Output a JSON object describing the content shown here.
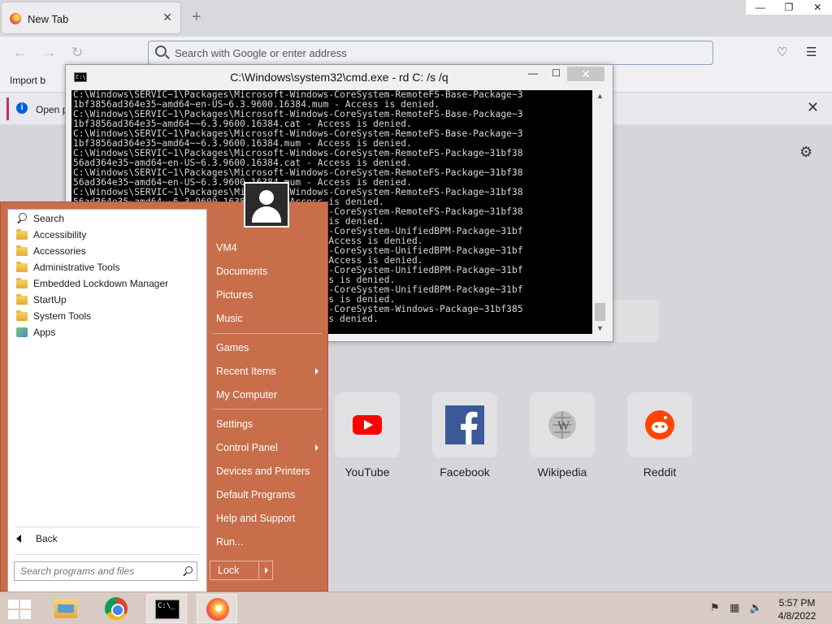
{
  "browser": {
    "tab_title": "New Tab",
    "tab_close": "✕",
    "new_tab": "+",
    "window_min": "—",
    "window_max": "❐",
    "window_close": "✕",
    "url_placeholder": "Search with Google or enter address",
    "bookmark_import": "Import b",
    "notice_text": "Open p",
    "notice_close": "✕",
    "icons": {
      "back": "arrow-left-icon",
      "forward": "arrow-right-icon",
      "reload": "reload-icon",
      "pocket": "pocket-icon",
      "menu": "hamburger-menu-icon",
      "settings": "gear-icon"
    }
  },
  "shortcuts": [
    {
      "label": "YouTube",
      "color": "#ff0000"
    },
    {
      "label": "Facebook",
      "color": "#1877f2"
    },
    {
      "label": "Wikipedia",
      "color": "#8d8d8d"
    },
    {
      "label": "Reddit",
      "color": "#ff4500"
    }
  ],
  "cmd": {
    "title": "C:\\Windows\\system32\\cmd.exe - rd  C: /s /q",
    "icon_text": "C:\\.",
    "min": "—",
    "max": "☐",
    "close": "✕",
    "lines": [
      "C:\\Windows\\SERVIC~1\\Packages\\Microsoft-Windows-CoreSystem-RemoteFS-Base-Package~3",
      "1bf3856ad364e35~amd64~en-US~6.3.9600.16384.mum - Access is denied.",
      "C:\\Windows\\SERVIC~1\\Packages\\Microsoft-Windows-CoreSystem-RemoteFS-Base-Package~3",
      "1bf3856ad364e35~amd64~~6.3.9600.16384.cat - Access is denied.",
      "C:\\Windows\\SERVIC~1\\Packages\\Microsoft-Windows-CoreSystem-RemoteFS-Base-Package~3",
      "1bf3856ad364e35~amd64~~6.3.9600.16384.mum - Access is denied.",
      "C:\\Windows\\SERVIC~1\\Packages\\Microsoft-Windows-CoreSystem-RemoteFS-Package~31bf38",
      "56ad364e35~amd64~en-US~6.3.9600.16384.cat - Access is denied.",
      "C:\\Windows\\SERVIC~1\\Packages\\Microsoft-Windows-CoreSystem-RemoteFS-Package~31bf38",
      "56ad364e35~amd64~en-US~6.3.9600.16384.mum - Access is denied.",
      "C:\\Windows\\SERVIC~1\\Packages\\Microsoft-Windows-CoreSystem-RemoteFS-Package~31bf38",
      "56ad364e35~amd64~~6.3.9600.16384.cat - Access is denied.",
      "C:\\Windows\\SERVIC~1\\Packages\\Microsoft-Windows-CoreSystem-RemoteFS-Package~31bf38",
      "56ad364e35~amd64~~6.3.9600.16384.mum - Access is denied.",
      "C:\\Windows\\SERVIC~1\\Packages\\Microsoft-Windows-CoreSystem-UnifiedBPM-Package~31bf",
      "3856ad364e35~amd64~en-US~6.3.9600.16384.cat - Access is denied.",
      "C:\\Windows\\SERVIC~1\\Packages\\Microsoft-Windows-CoreSystem-UnifiedBPM-Package~31bf",
      "3856ad364e35~amd64~en-US~6.3.9600.16384.mum - Access is denied.",
      "C:\\Windows\\SERVIC~1\\Packages\\Microsoft-Windows-CoreSystem-UnifiedBPM-Package~31bf",
      "3856ad364e35~amd64~~6.3.9600.16384.cat - Access is denied.",
      "C:\\Windows\\SERVIC~1\\Packages\\Microsoft-Windows-CoreSystem-UnifiedBPM-Package~31bf",
      "3856ad364e35~amd64~~6.3.9600.16384.mum - Access is denied.",
      "C:\\Windows\\SERVIC~1\\Packages\\Microsoft-Windows-CoreSystem-Windows-Package~31bf385",
      "6ad364e35~amd64~~6.3.9600.16384.cat - Access is denied."
    ]
  },
  "start_menu": {
    "accent": "#c96e4b",
    "programs": [
      {
        "label": "Search",
        "icon": "search-icon"
      },
      {
        "label": "Accessibility",
        "icon": "folder-icon"
      },
      {
        "label": "Accessories",
        "icon": "folder-icon"
      },
      {
        "label": "Administrative Tools",
        "icon": "folder-icon"
      },
      {
        "label": "Embedded Lockdown Manager",
        "icon": "folder-icon"
      },
      {
        "label": "StartUp",
        "icon": "folder-icon"
      },
      {
        "label": "System Tools",
        "icon": "folder-icon"
      },
      {
        "label": "Apps",
        "icon": "apps-icon"
      }
    ],
    "back_label": "Back",
    "search_placeholder": "Search programs and files",
    "right_items": [
      {
        "label": "VM4",
        "submenu": false
      },
      {
        "label": "Documents",
        "submenu": false
      },
      {
        "label": "Pictures",
        "submenu": false
      },
      {
        "label": "Music",
        "submenu": false
      },
      {
        "label": "Games",
        "submenu": false
      },
      {
        "label": "Recent Items",
        "submenu": true
      },
      {
        "label": "My Computer",
        "submenu": false
      },
      {
        "label": "Settings",
        "submenu": false
      },
      {
        "label": "Control Panel",
        "submenu": true
      },
      {
        "label": "Devices and Printers",
        "submenu": false
      },
      {
        "label": "Default Programs",
        "submenu": false
      },
      {
        "label": "Help and Support",
        "submenu": false
      },
      {
        "label": "Run...",
        "submenu": false
      }
    ],
    "lock_label": "Lock"
  },
  "taskbar": {
    "apps": [
      "file-explorer-icon",
      "chrome-icon",
      "command-prompt-icon",
      "firefox-icon"
    ],
    "time": "5:57 PM",
    "date": "4/8/2022"
  }
}
